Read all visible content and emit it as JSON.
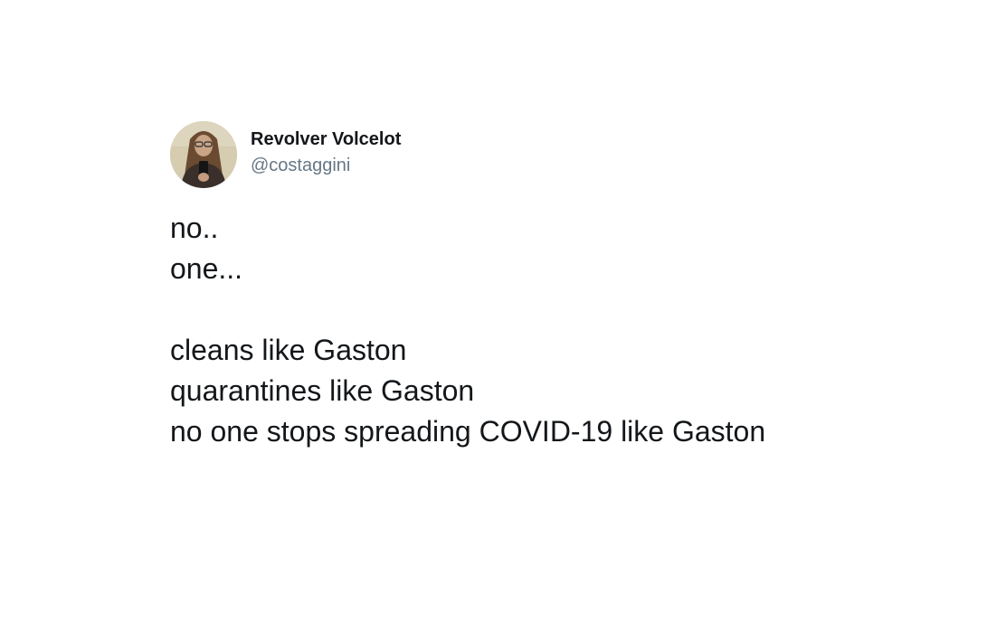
{
  "tweet": {
    "display_name": "Revolver Volcelot",
    "handle": "@costaggini",
    "lines": [
      "no..",
      "one...",
      "",
      "cleans like Gaston",
      "quarantines like Gaston",
      "no one stops spreading COVID-19 like Gaston"
    ]
  },
  "colors": {
    "background": "#ffffff",
    "text": "#14171a",
    "handle": "#657786"
  }
}
